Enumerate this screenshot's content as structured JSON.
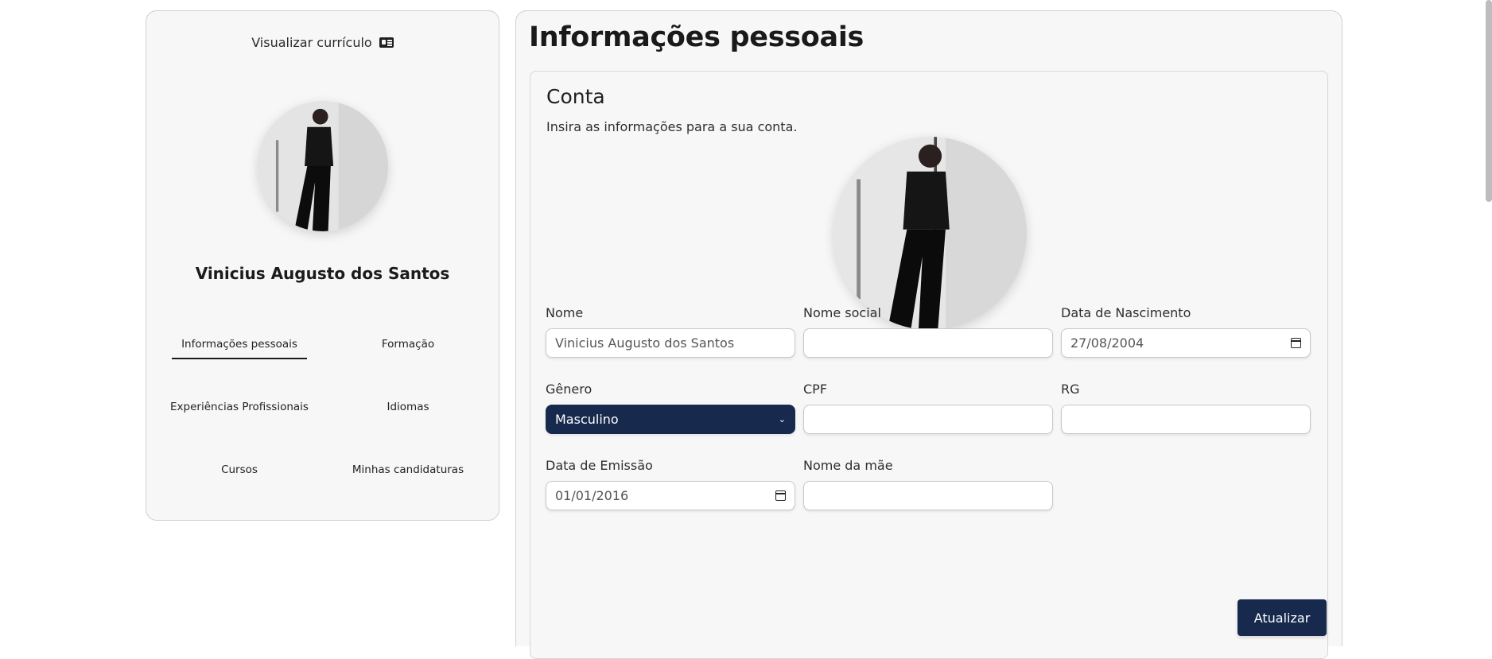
{
  "sidebar": {
    "resume_link": "Visualizar currículo",
    "user_name": "Vinicius Augusto dos Santos",
    "nav": [
      {
        "label": "Informações pessoais",
        "active": true
      },
      {
        "label": "Formação",
        "active": false
      },
      {
        "label": "Experiências Profissionais",
        "active": false
      },
      {
        "label": "Idiomas",
        "active": false
      },
      {
        "label": "Cursos",
        "active": false
      },
      {
        "label": "Minhas candidaturas",
        "active": false
      }
    ]
  },
  "main": {
    "title": "Informações pessoais",
    "card": {
      "title": "Conta",
      "subtitle": "Insira as informações para a sua conta."
    },
    "fields": {
      "nome": {
        "label": "Nome",
        "value": "Vinicius Augusto dos Santos"
      },
      "nome_social": {
        "label": "Nome social",
        "value": ""
      },
      "nascimento": {
        "label": "Data de Nascimento",
        "value": "27/08/2004"
      },
      "genero": {
        "label": "Gênero",
        "value": "Masculino"
      },
      "cpf": {
        "label": "CPF",
        "value": ""
      },
      "rg": {
        "label": "RG",
        "value": ""
      },
      "emissao": {
        "label": "Data de Emissão",
        "value": "01/01/2016"
      },
      "mae": {
        "label": "Nome da mãe",
        "value": ""
      }
    },
    "update_button": "Atualizar"
  },
  "colors": {
    "primary": "#172a4e",
    "panel": "#f7f7f7",
    "border": "#cfcfcf"
  },
  "icons": {
    "resume": "id-card-icon",
    "date": "calendar-icon",
    "select": "chevron-down-icon"
  }
}
